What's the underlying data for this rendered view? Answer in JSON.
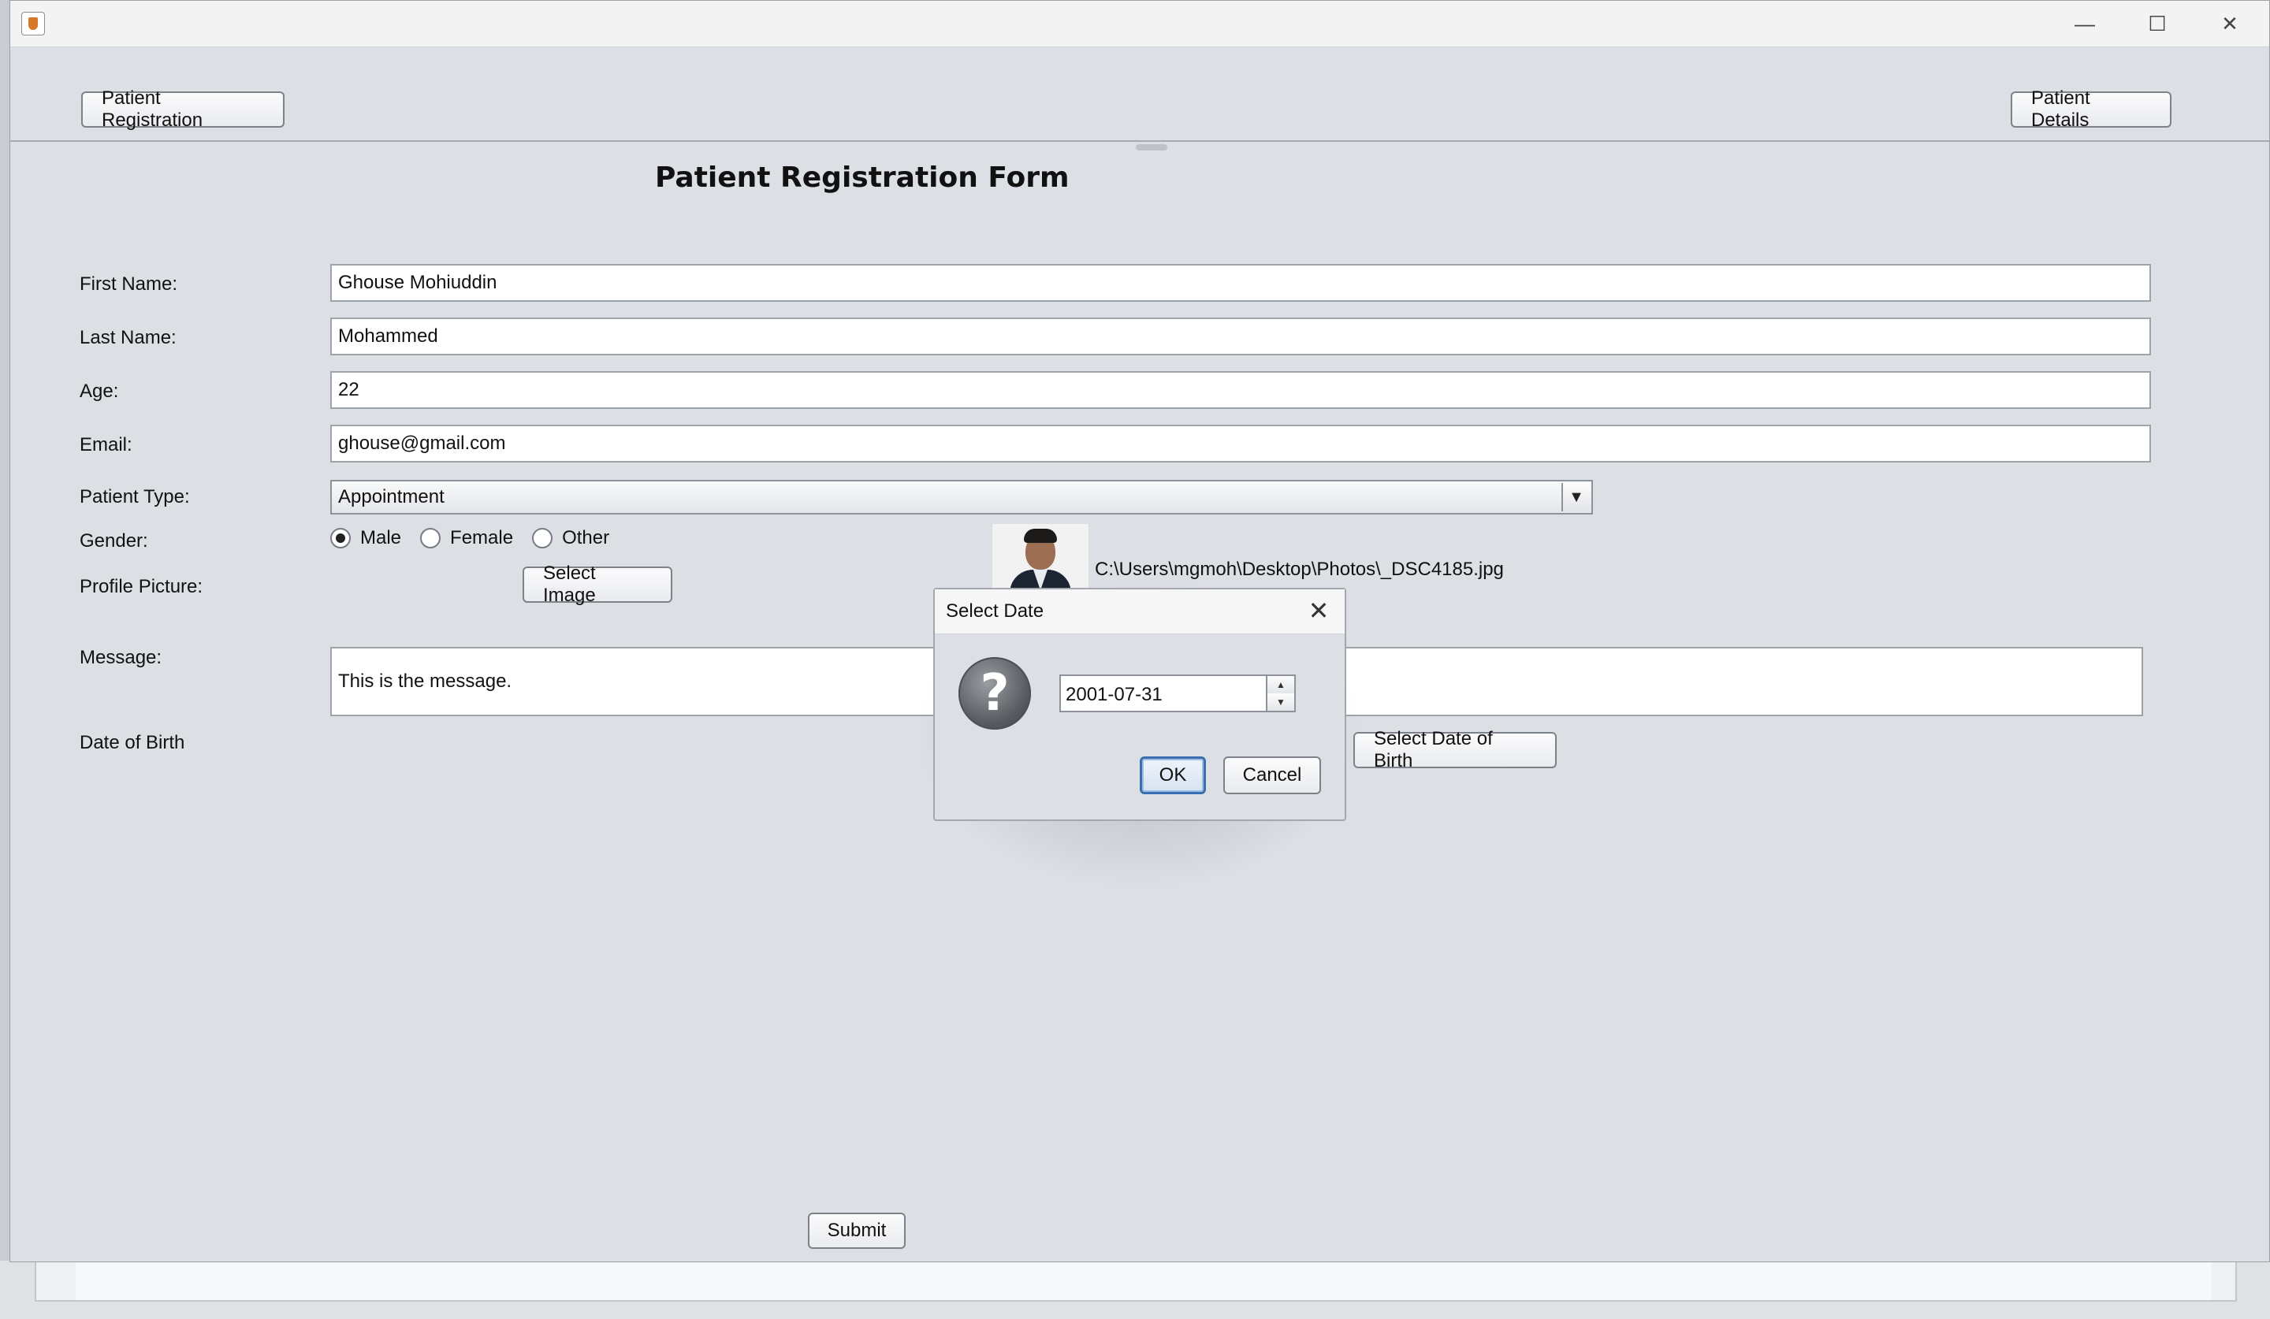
{
  "window": {
    "minimize_glyph": "—",
    "maximize_glyph": "☐",
    "close_glyph": "✕"
  },
  "toolbar": {
    "left_button": "Patient Registration",
    "right_button": "Patient Details"
  },
  "form": {
    "title": "Patient Registration Form",
    "first_name": {
      "label": "First Name:",
      "value": "Ghouse Mohiuddin"
    },
    "last_name": {
      "label": "Last Name:",
      "value": "Mohammed"
    },
    "age": {
      "label": "Age:",
      "value": "22"
    },
    "email": {
      "label": "Email:",
      "value": "ghouse@gmail.com"
    },
    "patient_type": {
      "label": "Patient Type:",
      "value": "Appointment",
      "arrow": "▼"
    },
    "gender": {
      "label": "Gender:",
      "options": [
        "Male",
        "Female",
        "Other"
      ],
      "selected": "Male"
    },
    "profile_picture": {
      "label": "Profile Picture:",
      "button": "Select Image",
      "path": "C:\\Users\\mgmoh\\Desktop\\Photos\\_DSC4185.jpg"
    },
    "message": {
      "label": "Message:",
      "value": "This is the message."
    },
    "dob": {
      "label": "Date of Birth",
      "button": "Select Date of Birth"
    },
    "submit": "Submit"
  },
  "dialog": {
    "title": "Select Date",
    "close_glyph": "✕",
    "icon_glyph": "?",
    "date_value": "2001-07-31",
    "spin_up": "▲",
    "spin_down": "▼",
    "ok": "OK",
    "cancel": "Cancel"
  }
}
